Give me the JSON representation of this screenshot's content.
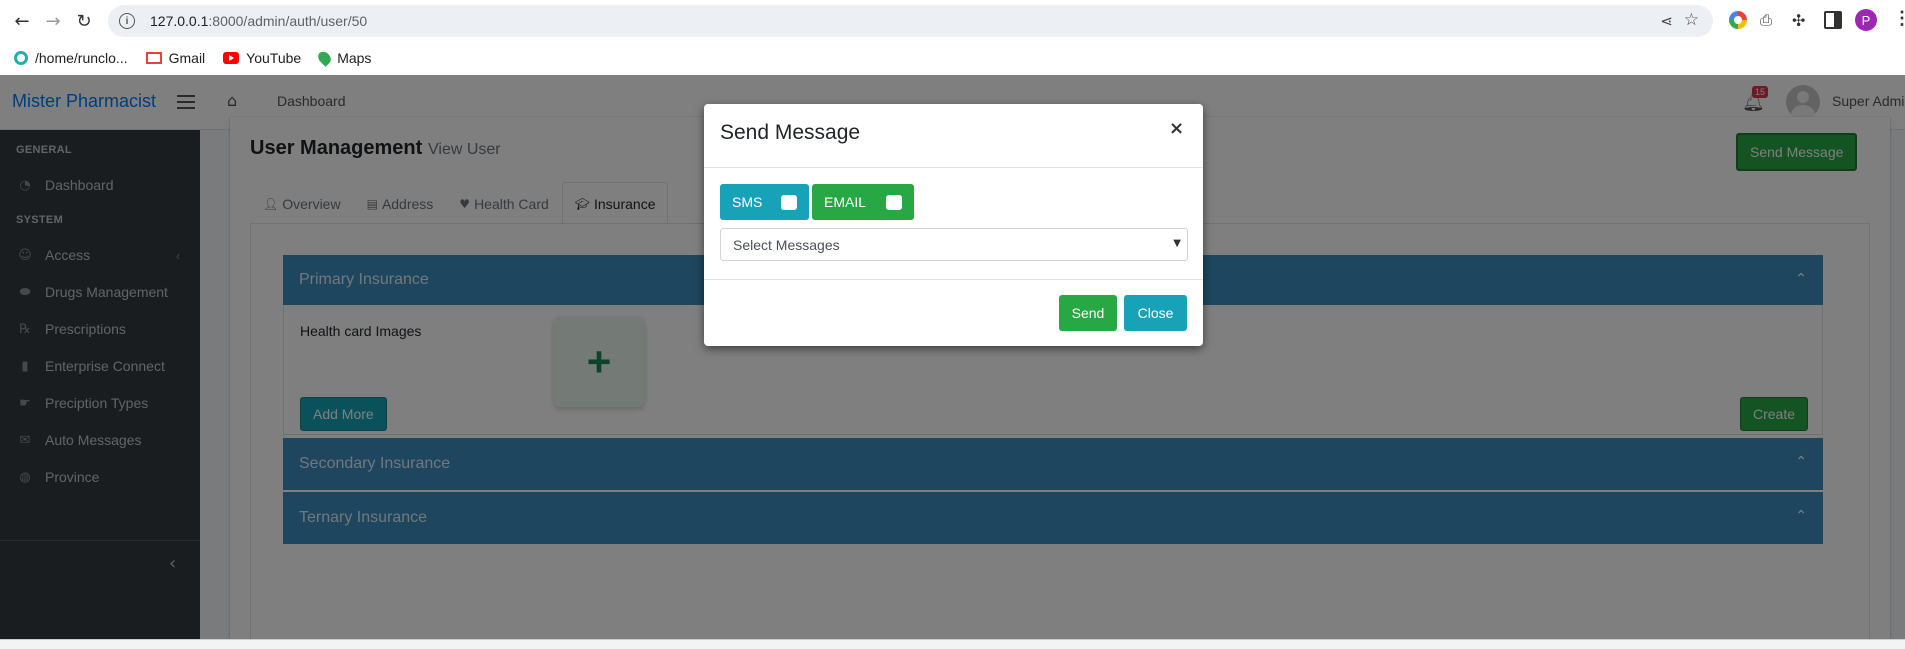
{
  "browser": {
    "url_host": "127.0.0.1",
    "url_path": ":8000/admin/auth/user/50",
    "profile_initial": "P",
    "bookmarks": [
      {
        "label": "/home/runclo...",
        "icon": "home-icon"
      },
      {
        "label": "Gmail",
        "icon": "gmail-icon"
      },
      {
        "label": "YouTube",
        "icon": "youtube-icon"
      },
      {
        "label": "Maps",
        "icon": "maps-icon"
      }
    ]
  },
  "header": {
    "brand": "Mister Pharmacist",
    "nav_dashboard": "Dashboard",
    "notification_count": "15",
    "user_name": "Super Admi"
  },
  "sidebar": {
    "section_general": "GENERAL",
    "section_system": "SYSTEM",
    "items": [
      {
        "label": "Dashboard",
        "icon": "dashboard-icon"
      },
      {
        "label": "Access",
        "icon": "user-icon"
      },
      {
        "label": "Drugs Management",
        "icon": "pills-icon"
      },
      {
        "label": "Prescriptions",
        "icon": "prescription-icon"
      },
      {
        "label": "Enterprise Connect",
        "icon": "file-icon"
      },
      {
        "label": "Preciption Types",
        "icon": "hand-icon"
      },
      {
        "label": "Auto Messages",
        "icon": "envelope-icon"
      },
      {
        "label": "Province",
        "icon": "globe-icon"
      }
    ]
  },
  "page": {
    "title": "User Management",
    "subtitle": "View User",
    "send_message_label": "Send Message",
    "tabs": [
      {
        "label": "Overview",
        "icon": "user-icon"
      },
      {
        "label": "Address",
        "icon": "address-card-icon"
      },
      {
        "label": "Health Card",
        "icon": "heart-icon"
      },
      {
        "label": "Insurance",
        "icon": "graduation-cap-icon"
      }
    ],
    "primary_insurance": "Primary Insurance",
    "health_card_images": "Health card Images",
    "add_more_label": "Add More",
    "create_label": "Create",
    "secondary_insurance": "Secondary Insurance",
    "ternary_insurance": "Ternary Insurance"
  },
  "modal": {
    "title": "Send Message",
    "close_symbol": "×",
    "sms_label": "SMS",
    "email_label": "EMAIL",
    "select_placeholder": "Select Messages",
    "send_label": "Send",
    "close_label": "Close"
  },
  "colors": {
    "brand": "#007bff",
    "sidebar_bg": "#343a40",
    "accordion": "#3c8dbc",
    "success": "#28a745",
    "info": "#17a2b8"
  }
}
